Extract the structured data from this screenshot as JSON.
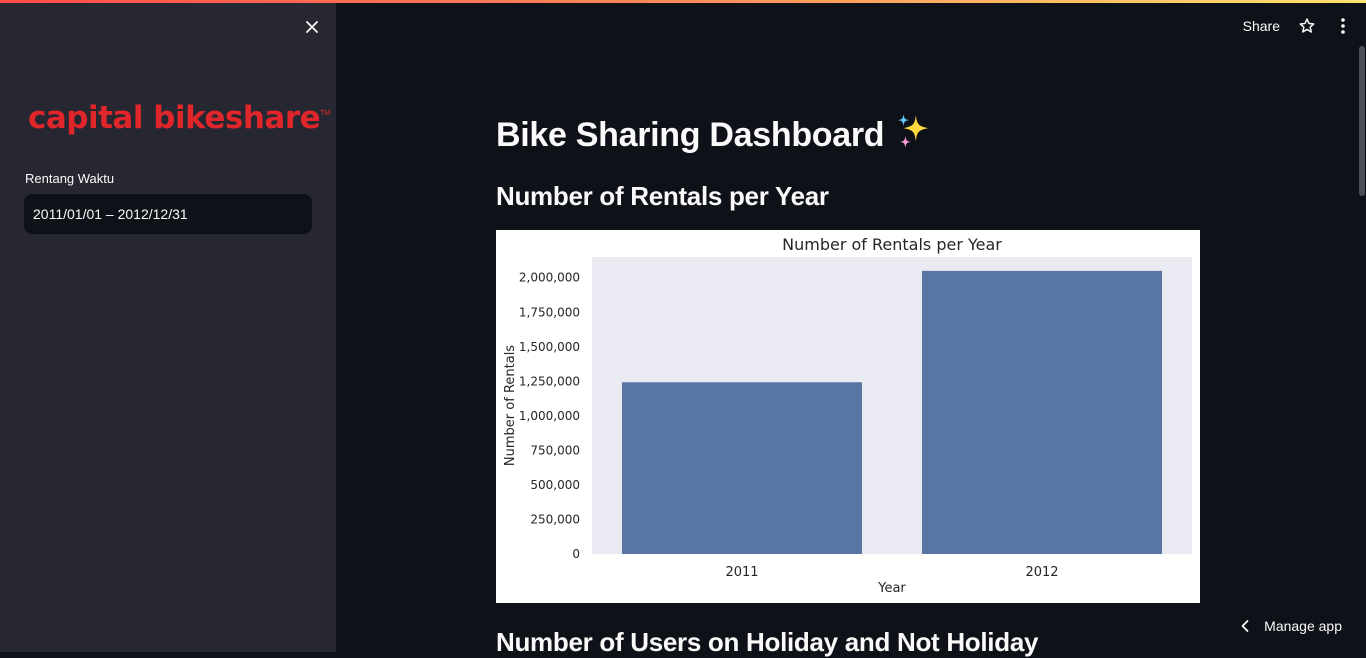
{
  "sidebar": {
    "logo_text": "capital bikeshare",
    "logo_tm": "TM",
    "date_label": "Rentang Waktu",
    "date_value": "2011/01/01 – 2012/12/31"
  },
  "header": {
    "share_label": "Share"
  },
  "main": {
    "title": "Bike Sharing Dashboard",
    "section1_title": "Number of Rentals per Year",
    "section2_title": "Number of Users on Holiday and Not Holiday"
  },
  "footer": {
    "manage_label": "Manage app"
  },
  "chart_data": {
    "type": "bar",
    "title": "Number of Rentals per Year",
    "xlabel": "Year",
    "ylabel": "Number of Rentals",
    "categories": [
      "2011",
      "2012"
    ],
    "values": [
      1243103,
      2049576
    ],
    "ylim": [
      0,
      2150000
    ],
    "yticks": [
      0,
      250000,
      500000,
      750000,
      1000000,
      1250000,
      1500000,
      1750000,
      2000000
    ],
    "ytick_labels": [
      "0",
      "250,000",
      "500,000",
      "750,000",
      "1,000,000",
      "1,250,000",
      "1,500,000",
      "1,750,000",
      "2,000,000"
    ],
    "bar_color": "#5975a4",
    "plot_bg": "#eaeaf2",
    "grid": false
  }
}
